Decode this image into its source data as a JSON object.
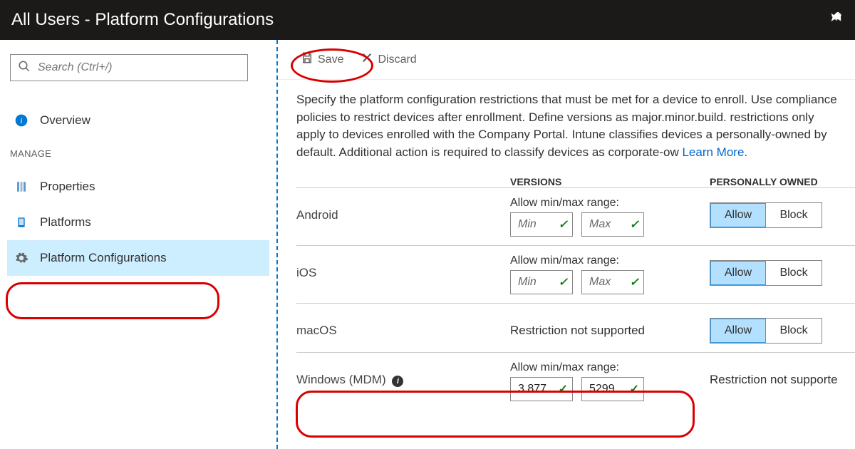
{
  "header": {
    "title": "All Users - Platform Configurations"
  },
  "search": {
    "placeholder": "Search (Ctrl+/)"
  },
  "sidebar": {
    "overview": "Overview",
    "manage_label": "MANAGE",
    "properties": "Properties",
    "platforms": "Platforms",
    "platform_configs": "Platform Configurations"
  },
  "toolbar": {
    "save": "Save",
    "discard": "Discard"
  },
  "intro": {
    "text": "Specify the platform configuration restrictions that must be met for a device to enroll. Use compliance policies to restrict devices after enrollment. Define versions as major.minor.build. restrictions only apply to devices enrolled with the Company Portal. Intune classifies devices a personally-owned by default. Additional action is required to classify devices as corporate-ow",
    "learn_more": "Learn More."
  },
  "columns": {
    "versions": "VERSIONS",
    "owned": "PERSONALLY OWNED"
  },
  "labels": {
    "range": "Allow min/max range:",
    "not_supported": "Restriction not supported",
    "not_supported_owned": "Restriction not supporte",
    "min": "Min",
    "max": "Max",
    "allow": "Allow",
    "block": "Block"
  },
  "rows": {
    "android": {
      "name": "Android"
    },
    "ios": {
      "name": "iOS"
    },
    "macos": {
      "name": "macOS"
    },
    "windows": {
      "name": "Windows (MDM)",
      "min": "3.877",
      "max": "5299."
    }
  }
}
